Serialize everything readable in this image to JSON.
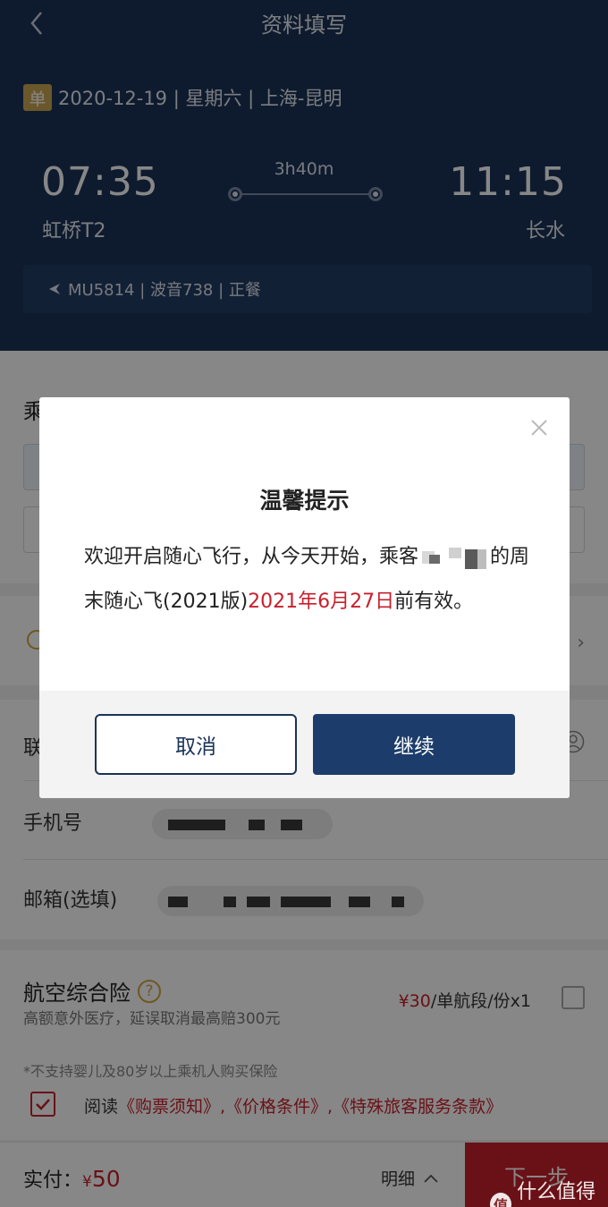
{
  "header": {
    "title": "资料填写",
    "trip_badge": "单",
    "trip_info": "2020-12-19 | 星期六 | 上海-昆明",
    "departure_time": "07:35",
    "departure_airport": "虹桥T2",
    "arrival_time": "11:15",
    "arrival_airport": "长水",
    "duration": "3h40m",
    "flight_info": "MU5814 | 波音738 | 正餐"
  },
  "passenger": {
    "label": "乘"
  },
  "contact": {
    "label": "联",
    "phone_label": "手机号",
    "email_label": "邮箱(选填)"
  },
  "insurance": {
    "title": "航空综合险",
    "help": "?",
    "description": "高额意外医疗，延误取消最高赔300元",
    "price_amount": "¥30",
    "price_unit": "/单航段/份x1",
    "note": "*不支持婴儿及80岁以上乘机人购买保险"
  },
  "agreement": {
    "prefix": "阅读",
    "links": "《购票须知》,《价格条件》,《特殊旅客服务条款》"
  },
  "bottom_bar": {
    "pay_label": "实付：",
    "currency": "¥",
    "amount": "50",
    "detail_label": "明细",
    "next_label": "下一步"
  },
  "dialog": {
    "title": "温馨提示",
    "message_part1": "欢迎开启随心飞行，从今天开始，乘客",
    "message_part2": "的周末随心飞(2021版)",
    "message_date": "2021年6月27日",
    "message_part3": "前有效。",
    "cancel_label": "取消",
    "continue_label": "继续"
  },
  "watermark": {
    "badge": "值",
    "text": "什么值得买"
  },
  "colors": {
    "header_bg": "#1b3358",
    "accent_red": "#c8202c",
    "primary_button": "#1c3d6b",
    "badge_gold": "#c9a452"
  }
}
